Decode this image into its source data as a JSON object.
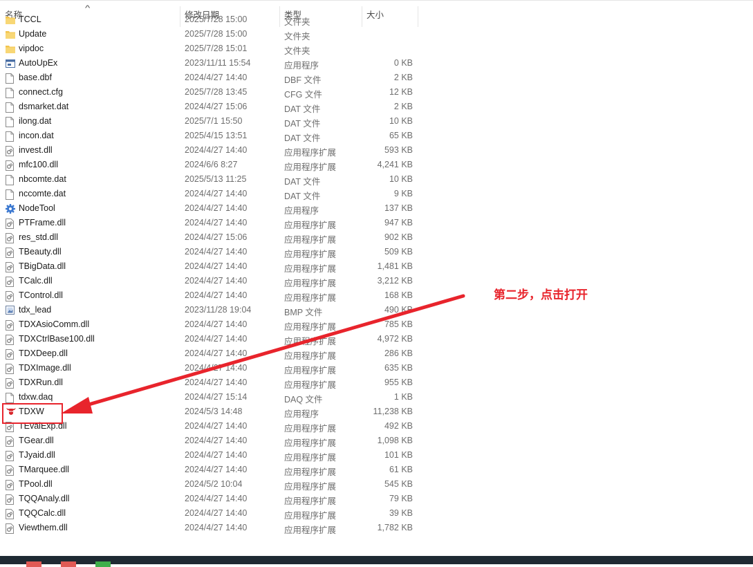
{
  "header": {
    "name": "名称",
    "date": "修改日期",
    "type": "类型",
    "size": "大小",
    "sort_icon": "chevron-up-icon"
  },
  "files": [
    {
      "name": "TCCL",
      "date": "2025/7/28 15:00",
      "type": "文件夹",
      "size": "",
      "icon": "folder"
    },
    {
      "name": "Update",
      "date": "2025/7/28 15:00",
      "type": "文件夹",
      "size": "",
      "icon": "folder"
    },
    {
      "name": "vipdoc",
      "date": "2025/7/28 15:01",
      "type": "文件夹",
      "size": "",
      "icon": "folder"
    },
    {
      "name": "AutoUpEx",
      "date": "2023/11/11 15:54",
      "type": "应用程序",
      "size": "0 KB",
      "icon": "app"
    },
    {
      "name": "base.dbf",
      "date": "2024/4/27 14:40",
      "type": "DBF 文件",
      "size": "2 KB",
      "icon": "file"
    },
    {
      "name": "connect.cfg",
      "date": "2025/7/28 13:45",
      "type": "CFG 文件",
      "size": "12 KB",
      "icon": "file"
    },
    {
      "name": "dsmarket.dat",
      "date": "2024/4/27 15:06",
      "type": "DAT 文件",
      "size": "2 KB",
      "icon": "file"
    },
    {
      "name": "ilong.dat",
      "date": "2025/7/1 15:50",
      "type": "DAT 文件",
      "size": "10 KB",
      "icon": "file"
    },
    {
      "name": "incon.dat",
      "date": "2025/4/15 13:51",
      "type": "DAT 文件",
      "size": "65 KB",
      "icon": "file"
    },
    {
      "name": "invest.dll",
      "date": "2024/4/27 14:40",
      "type": "应用程序扩展",
      "size": "593 KB",
      "icon": "dll"
    },
    {
      "name": "mfc100.dll",
      "date": "2024/6/6 8:27",
      "type": "应用程序扩展",
      "size": "4,241 KB",
      "icon": "dll"
    },
    {
      "name": "nbcomte.dat",
      "date": "2025/5/13 11:25",
      "type": "DAT 文件",
      "size": "10 KB",
      "icon": "file"
    },
    {
      "name": "nccomte.dat",
      "date": "2024/4/27 14:40",
      "type": "DAT 文件",
      "size": "9 KB",
      "icon": "file"
    },
    {
      "name": "NodeTool",
      "date": "2024/4/27 14:40",
      "type": "应用程序",
      "size": "137 KB",
      "icon": "gear"
    },
    {
      "name": "PTFrame.dll",
      "date": "2024/4/27 14:40",
      "type": "应用程序扩展",
      "size": "947 KB",
      "icon": "dll"
    },
    {
      "name": "res_std.dll",
      "date": "2024/4/27 15:06",
      "type": "应用程序扩展",
      "size": "902 KB",
      "icon": "dll"
    },
    {
      "name": "TBeauty.dll",
      "date": "2024/4/27 14:40",
      "type": "应用程序扩展",
      "size": "509 KB",
      "icon": "dll"
    },
    {
      "name": "TBigData.dll",
      "date": "2024/4/27 14:40",
      "type": "应用程序扩展",
      "size": "1,481 KB",
      "icon": "dll"
    },
    {
      "name": "TCalc.dll",
      "date": "2024/4/27 14:40",
      "type": "应用程序扩展",
      "size": "3,212 KB",
      "icon": "dll"
    },
    {
      "name": "TControl.dll",
      "date": "2024/4/27 14:40",
      "type": "应用程序扩展",
      "size": "168 KB",
      "icon": "dll"
    },
    {
      "name": "tdx_lead",
      "date": "2023/11/28 19:04",
      "type": "BMP 文件",
      "size": "490 KB",
      "icon": "bmp"
    },
    {
      "name": "TDXAsioComm.dll",
      "date": "2024/4/27 14:40",
      "type": "应用程序扩展",
      "size": "785 KB",
      "icon": "dll"
    },
    {
      "name": "TDXCtrlBase100.dll",
      "date": "2024/4/27 14:40",
      "type": "应用程序扩展",
      "size": "4,972 KB",
      "icon": "dll"
    },
    {
      "name": "TDXDeep.dll",
      "date": "2024/4/27 14:40",
      "type": "应用程序扩展",
      "size": "286 KB",
      "icon": "dll"
    },
    {
      "name": "TDXImage.dll",
      "date": "2024/4/27 14:40",
      "type": "应用程序扩展",
      "size": "635 KB",
      "icon": "dll"
    },
    {
      "name": "TDXRun.dll",
      "date": "2024/4/27 14:40",
      "type": "应用程序扩展",
      "size": "955 KB",
      "icon": "dll"
    },
    {
      "name": "tdxw.daq",
      "date": "2024/4/27 15:14",
      "type": "DAQ 文件",
      "size": "1 KB",
      "icon": "file"
    },
    {
      "name": "TDXW",
      "date": "2024/5/3 14:48",
      "type": "应用程序",
      "size": "11,238 KB",
      "icon": "tdx"
    },
    {
      "name": "TEvalExp.dll",
      "date": "2024/4/27 14:40",
      "type": "应用程序扩展",
      "size": "492 KB",
      "icon": "dll"
    },
    {
      "name": "TGear.dll",
      "date": "2024/4/27 14:40",
      "type": "应用程序扩展",
      "size": "1,098 KB",
      "icon": "dll"
    },
    {
      "name": "TJyaid.dll",
      "date": "2024/4/27 14:40",
      "type": "应用程序扩展",
      "size": "101 KB",
      "icon": "dll"
    },
    {
      "name": "TMarquee.dll",
      "date": "2024/4/27 14:40",
      "type": "应用程序扩展",
      "size": "61 KB",
      "icon": "dll"
    },
    {
      "name": "TPool.dll",
      "date": "2024/5/2 10:04",
      "type": "应用程序扩展",
      "size": "545 KB",
      "icon": "dll"
    },
    {
      "name": "TQQAnaly.dll",
      "date": "2024/4/27 14:40",
      "type": "应用程序扩展",
      "size": "79 KB",
      "icon": "dll"
    },
    {
      "name": "TQQCalc.dll",
      "date": "2024/4/27 14:40",
      "type": "应用程序扩展",
      "size": "39 KB",
      "icon": "dll"
    },
    {
      "name": "Viewthem.dll",
      "date": "2024/4/27 14:40",
      "type": "应用程序扩展",
      "size": "1,782 KB",
      "icon": "dll"
    }
  ],
  "annotation": {
    "text": "第二步，点击打开",
    "color": "#e8242c"
  },
  "colors": {
    "folder": "#f3c44d",
    "annotation_red": "#e8242c",
    "taskbar": "#1f2a33"
  }
}
